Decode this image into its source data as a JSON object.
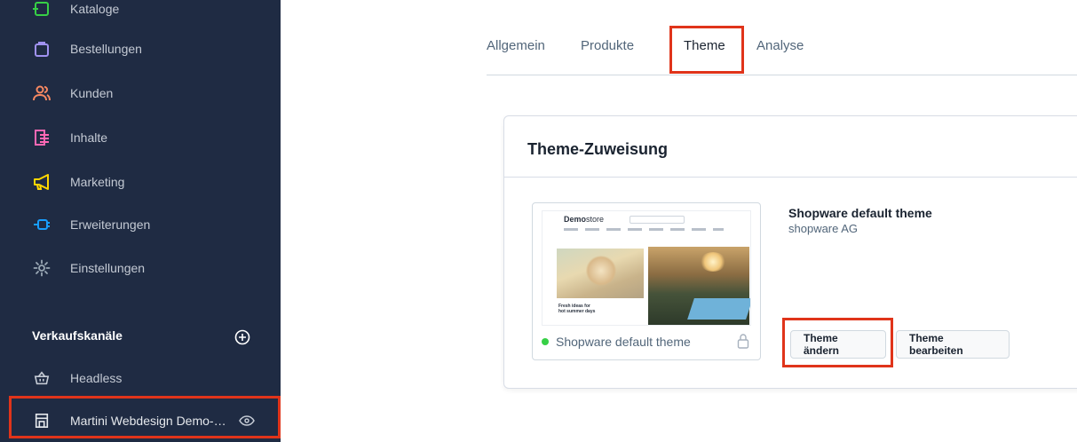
{
  "sidebar": {
    "items": [
      {
        "label": "Kataloge",
        "icon": "catalog-icon",
        "color": "#37d046"
      },
      {
        "label": "Bestellungen",
        "icon": "shopping-bag-icon",
        "color": "#a092f0"
      },
      {
        "label": "Kunden",
        "icon": "customers-icon",
        "color": "#f88962"
      },
      {
        "label": "Inhalte",
        "icon": "content-icon",
        "color": "#ff68b4"
      },
      {
        "label": "Marketing",
        "icon": "megaphone-icon",
        "color": "#ffd700"
      },
      {
        "label": "Erweiterungen",
        "icon": "plug-icon",
        "color": "#189eff"
      },
      {
        "label": "Einstellungen",
        "icon": "gear-icon",
        "color": "#9aa8b5"
      }
    ],
    "sales_channels_title": "Verkaufskanäle",
    "channels": [
      {
        "label": "Headless",
        "icon": "basket-icon"
      },
      {
        "label": "Martini Webdesign Demo-…",
        "icon": "storefront-icon"
      }
    ]
  },
  "tabs": {
    "items": [
      "Allgemein",
      "Produkte",
      "Theme",
      "Analyse"
    ],
    "active": "Theme"
  },
  "card": {
    "title": "Theme-Zuweisung",
    "preview": {
      "name": "Shopware default theme",
      "mini_logo_bold": "Demo",
      "mini_logo_light": "store",
      "mini_heading": "Fresh ideas for\nhot summer days",
      "status_color": "#37d046"
    },
    "theme_name": "Shopware default theme",
    "theme_author": "shopware AG",
    "change_button": "Theme ändern",
    "edit_button": "Theme bearbeiten"
  },
  "colors": {
    "sidebar_bg": "#1f2b43",
    "accent": "#189eff",
    "highlight": "#e0341a"
  }
}
